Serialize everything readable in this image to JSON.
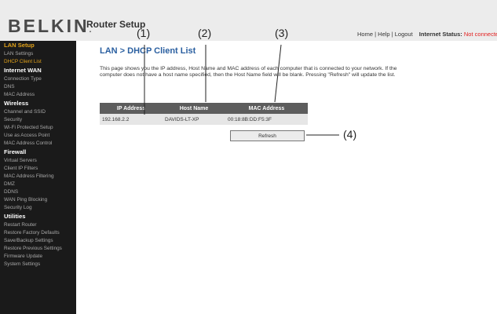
{
  "header": {
    "logo": "BELKIN",
    "logo_mark": ".",
    "app_title": "Router Setup",
    "nav": {
      "home": "Home",
      "help": "Help",
      "logout": "Logout",
      "separator": "|",
      "status_label": "Internet Status:",
      "status_value": "Not connected"
    }
  },
  "sidebar": {
    "sections": [
      {
        "heading": "LAN Setup",
        "items": [
          "LAN Settings",
          "DHCP Client List"
        ]
      },
      {
        "heading": "Internet WAN",
        "items": [
          "Connection Type",
          "DNS",
          "MAC Address"
        ]
      },
      {
        "heading": "Wireless",
        "items": [
          "Channel and SSID",
          "Security",
          "Wi-Fi Protected Setup",
          "Use as Access Point",
          "MAC Address Control"
        ]
      },
      {
        "heading": "Firewall",
        "items": [
          "Virtual Servers",
          "Client IP Filters",
          "MAC Address Filtering",
          "DMZ",
          "DDNS",
          "WAN Ping Blocking",
          "Security Log"
        ]
      },
      {
        "heading": "Utilities",
        "items": [
          "Restart Router",
          "Restore Factory Defaults",
          "Save/Backup Settings",
          "Restore Previous Settings",
          "Firmware Update",
          "System Settings"
        ]
      }
    ],
    "active_item": "DHCP Client List"
  },
  "main": {
    "title": "LAN > DHCP Client List",
    "description": "This page shows you the IP address, Host Name and MAC address of each computer that is connected to your network. If the computer does not have a host name specified, then the Host Name field will be blank. Pressing \"Refresh\" will update the list.",
    "table": {
      "headers": [
        "IP Address",
        "Host Name",
        "MAC Address"
      ],
      "rows": [
        [
          "192.168.2.2",
          "DAVIDS-LT-XP",
          "00:18:8B:DD:F5:3F"
        ]
      ]
    },
    "refresh_label": "Refresh"
  },
  "callouts": [
    "(1)",
    "(2)",
    "(3)",
    "(4)"
  ],
  "colors": {
    "sidebar_bg": "#1a1a1a",
    "sidebar_accent": "#e0a11a",
    "title_blue": "#2a5fa0",
    "table_header": "#5d5d5d",
    "status_red": "#e21d1d"
  }
}
